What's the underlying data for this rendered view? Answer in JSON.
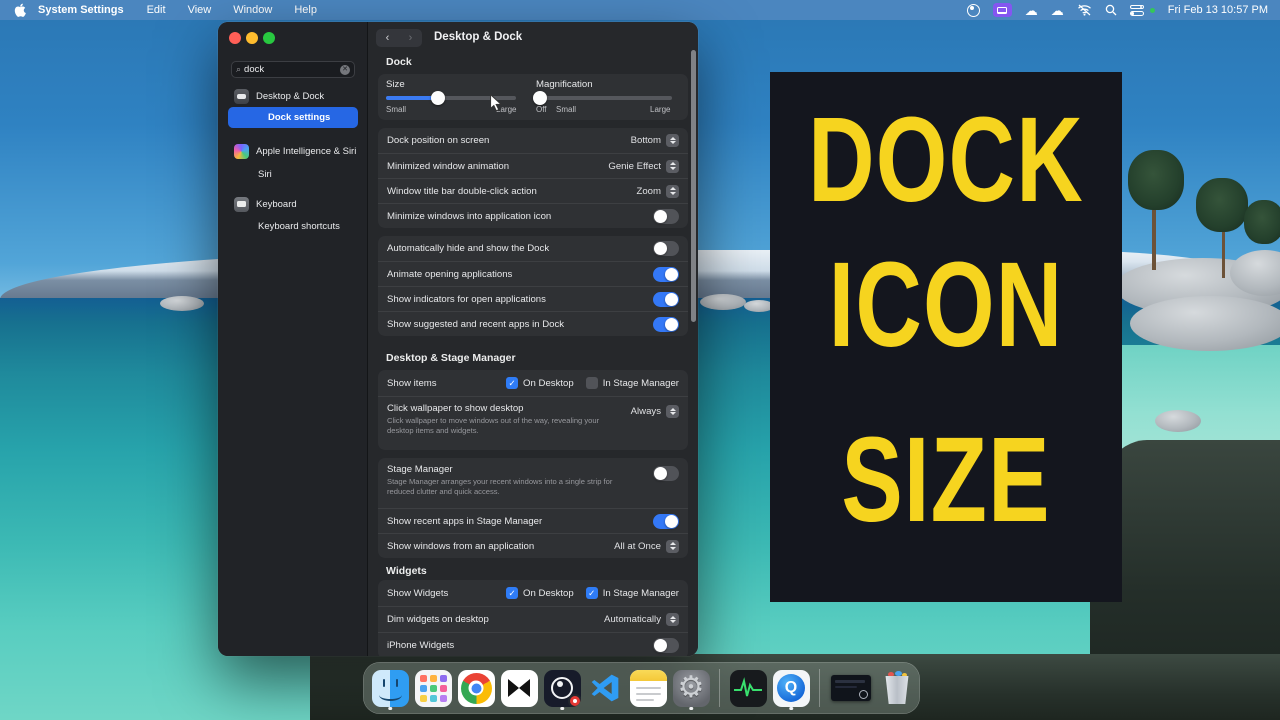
{
  "menu_bar": {
    "apple_icon": "apple-logo",
    "items": [
      "System Settings",
      "Edit",
      "View",
      "Window",
      "Help"
    ],
    "status_icons": [
      "obs-icon",
      "screen-mirroring-icon",
      "cloud-sync-icon",
      "cloud-icon",
      "wifi-off-icon",
      "spotlight-search-icon",
      "control-center-icon"
    ],
    "clock": "Fri Feb 13 10:57 PM"
  },
  "window": {
    "sidebar": {
      "search": {
        "value": "dock"
      },
      "items": [
        {
          "label": "Desktop & Dock",
          "icon": "dock-pref-icon"
        },
        {
          "label": "Dock settings",
          "selected": true
        },
        {
          "label": "Apple Intelligence & Siri",
          "icon": "apple-intelligence-icon"
        },
        {
          "label": "Siri"
        },
        {
          "label": "Keyboard",
          "icon": "keyboard-icon"
        },
        {
          "label": "Keyboard shortcuts"
        }
      ]
    },
    "header": {
      "title": "Desktop & Dock"
    },
    "dock_section": {
      "header": "Dock",
      "size": {
        "label": "Size",
        "min": "Small",
        "max": "Large",
        "pct": 40
      },
      "magnification": {
        "label": "Magnification",
        "off": "Off",
        "min": "Small",
        "max": "Large",
        "pct": 3
      },
      "group1": [
        {
          "label": "Dock position on screen",
          "value": "Bottom"
        },
        {
          "label": "Minimized window animation",
          "value": "Genie Effect"
        },
        {
          "label": "Window title bar double-click action",
          "value": "Zoom"
        },
        {
          "label": "Minimize windows into application icon",
          "toggle": false
        }
      ],
      "group2": [
        {
          "label": "Automatically hide and show the Dock",
          "toggle": false
        },
        {
          "label": "Animate opening applications",
          "toggle": true
        },
        {
          "label": "Show indicators for open applications",
          "toggle": true
        },
        {
          "label": "Show suggested and recent apps in Dock",
          "toggle": true
        }
      ]
    },
    "desktop_section": {
      "header": "Desktop & Stage Manager",
      "show_items": {
        "label": "Show items",
        "options": [
          {
            "label": "On Desktop",
            "checked": true
          },
          {
            "label": "In Stage Manager",
            "checked": false
          }
        ]
      },
      "click_wallpaper": {
        "label": "Click wallpaper to show desktop",
        "subtitle": "Click wallpaper to move windows out of the way, revealing your desktop items and widgets.",
        "value": "Always"
      },
      "stage_manager": {
        "label": "Stage Manager",
        "subtitle": "Stage Manager arranges your recent windows into a single strip for reduced clutter and quick access.",
        "toggle": false
      },
      "recent_apps": {
        "label": "Show recent apps in Stage Manager",
        "toggle": true
      },
      "show_windows": {
        "label": "Show windows from an application",
        "value": "All at Once"
      }
    },
    "widgets_section": {
      "header": "Widgets",
      "show_widgets": {
        "label": "Show Widgets",
        "options": [
          {
            "label": "On Desktop",
            "checked": true
          },
          {
            "label": "In Stage Manager",
            "checked": true
          }
        ]
      },
      "dim_widgets": {
        "label": "Dim widgets on desktop",
        "value": "Automatically"
      },
      "iphone_widgets": {
        "label": "iPhone Widgets",
        "toggle": false
      }
    }
  },
  "overlay": {
    "lines": [
      "DOCK",
      "ICON",
      "SIZE"
    ],
    "text_color": "#F6D41F",
    "bg_color": "#14161E"
  },
  "dock": {
    "apps": [
      "finder",
      "launchpad",
      "chrome",
      "capcut",
      "obs-studio",
      "vscode",
      "notes",
      "system-settings",
      "activity-monitor",
      "quicktime",
      "minimized-window",
      "trash"
    ],
    "running_indicators": [
      "finder",
      "obs-studio",
      "system-settings",
      "quicktime"
    ]
  },
  "colors": {
    "accent_blue": "#2f7cf6",
    "selected_row_blue": "#2667e4",
    "toggle_on_blue": "#3478f6",
    "menu_bar_blue": "#4e88c0"
  }
}
